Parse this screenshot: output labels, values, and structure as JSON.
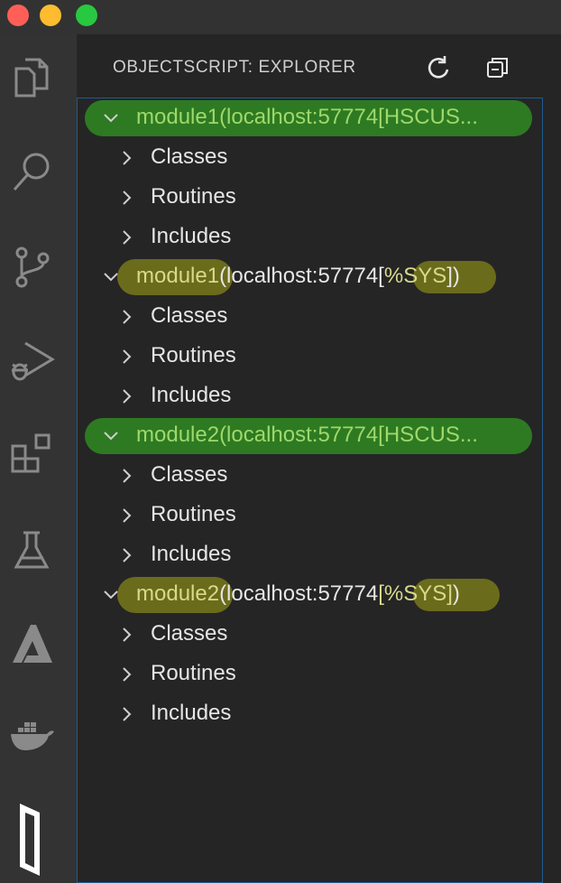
{
  "window": {
    "controls": [
      {
        "name": "close",
        "color": "#ff5f57"
      },
      {
        "name": "minimize",
        "color": "#febc2e"
      },
      {
        "name": "zoom",
        "color": "#28c840"
      }
    ]
  },
  "activity_bar": {
    "icons": [
      "files-icon",
      "search-icon",
      "source-control-icon",
      "run-debug-icon",
      "extensions-icon",
      "testing-icon",
      "azure-icon",
      "docker-icon",
      "intersystems-icon"
    ]
  },
  "explorer": {
    "title": "OBJECTSCRIPT: EXPLORER",
    "refresh_icon": "refresh-icon",
    "collapse_icon": "collapse-all-icon",
    "roots": [
      {
        "name_part": "module1",
        "connection_part": "(localhost:57774[HSCUS...",
        "namespace": "",
        "suffix": "",
        "highlight": "green",
        "children": [
          "Classes",
          "Routines",
          "Includes"
        ]
      },
      {
        "name_part": "module1",
        "connection_part": "(localhost:57774[",
        "namespace": "%SYS",
        "suffix": "])",
        "highlight": "olive",
        "children": [
          "Classes",
          "Routines",
          "Includes"
        ]
      },
      {
        "name_part": "module2",
        "connection_part": "(localhost:57774[HSCUS...",
        "namespace": "",
        "suffix": "",
        "highlight": "green",
        "children": [
          "Classes",
          "Routines",
          "Includes"
        ]
      },
      {
        "name_part": "module2",
        "connection_part": "(localhost:57774",
        "namespace": "[%SYS]",
        "suffix": ")",
        "highlight": "olive",
        "children": [
          "Classes",
          "Routines",
          "Includes"
        ]
      }
    ]
  }
}
